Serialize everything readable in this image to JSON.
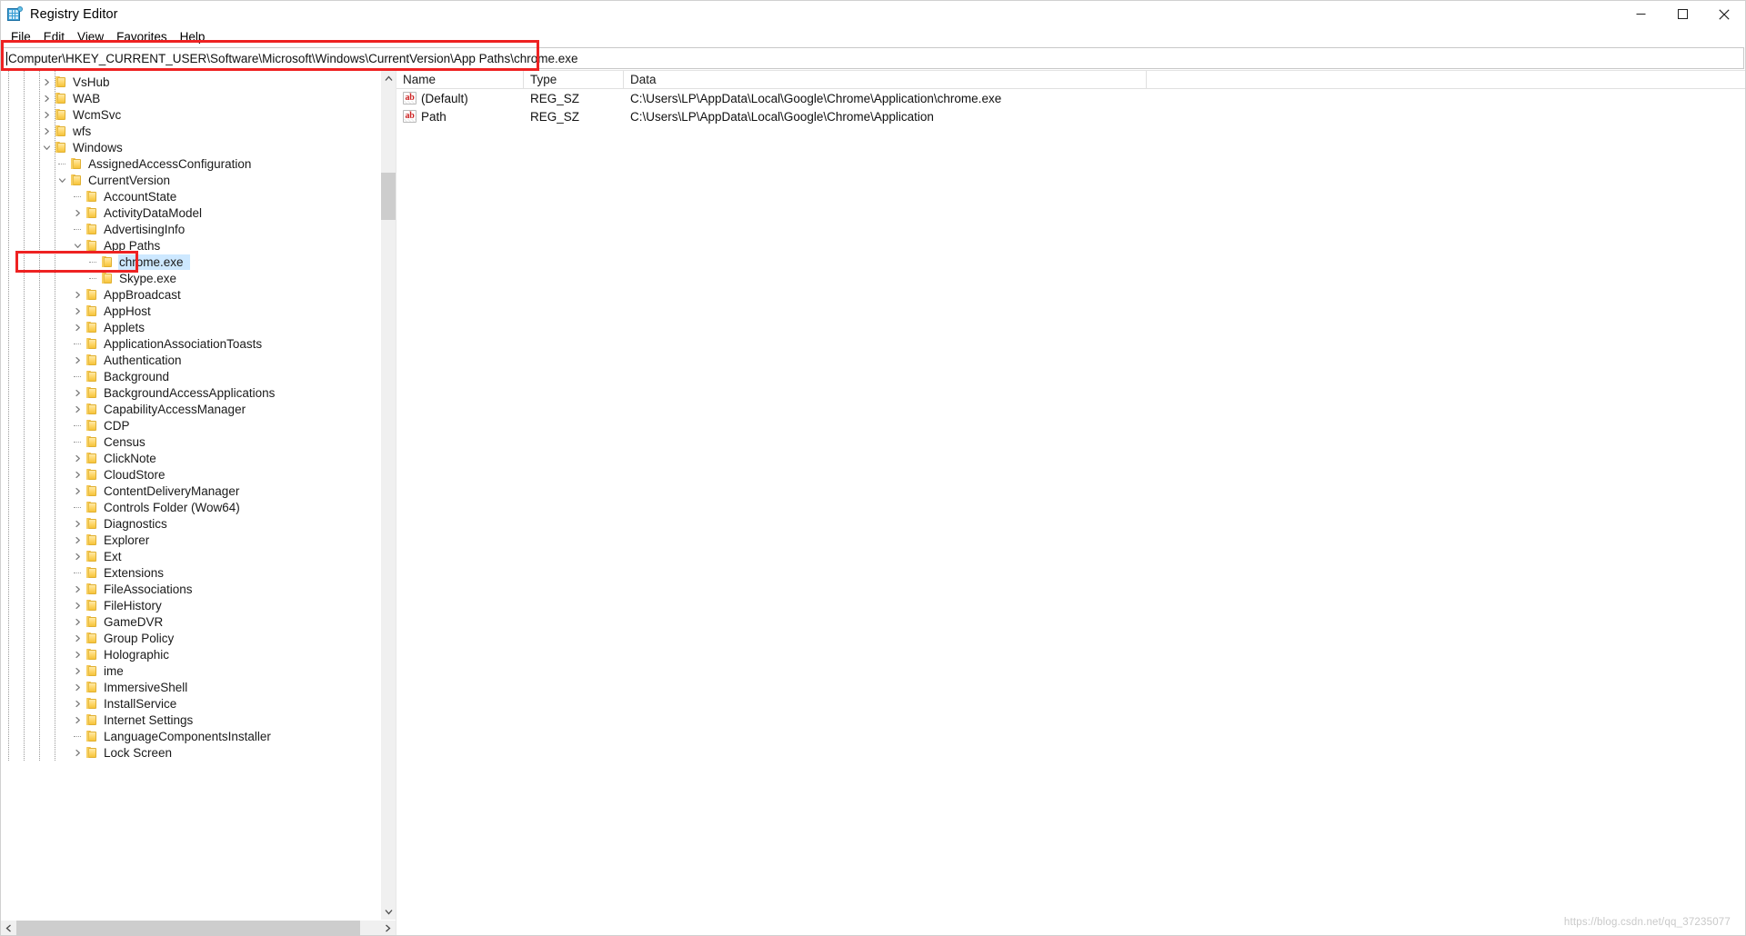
{
  "window": {
    "title": "Registry Editor",
    "icon": "registry-editor-icon",
    "minimize_label": "Minimize",
    "maximize_label": "Maximize",
    "close_label": "Close"
  },
  "menubar": {
    "items": [
      {
        "label": "File",
        "accel": "F"
      },
      {
        "label": "Edit",
        "accel": "E"
      },
      {
        "label": "View",
        "accel": "V"
      },
      {
        "label": "Favorites",
        "accel": "a"
      },
      {
        "label": "Help",
        "accel": "H"
      }
    ]
  },
  "address": {
    "value": "Computer\\HKEY_CURRENT_USER\\Software\\Microsoft\\Windows\\CurrentVersion\\App Paths\\chrome.exe",
    "placeholder": "Computer"
  },
  "tree": {
    "rows": [
      {
        "label": "VsHub",
        "indent": 3,
        "twisty": "collapsed",
        "selected": false
      },
      {
        "label": "WAB",
        "indent": 3,
        "twisty": "collapsed",
        "selected": false
      },
      {
        "label": "WcmSvc",
        "indent": 3,
        "twisty": "collapsed",
        "selected": false
      },
      {
        "label": "wfs",
        "indent": 3,
        "twisty": "collapsed",
        "selected": false
      },
      {
        "label": "Windows",
        "indent": 3,
        "twisty": "expanded",
        "selected": false
      },
      {
        "label": "AssignedAccessConfiguration",
        "indent": 4,
        "twisty": "leaf",
        "selected": false
      },
      {
        "label": "CurrentVersion",
        "indent": 4,
        "twisty": "expanded",
        "selected": false
      },
      {
        "label": "AccountState",
        "indent": 5,
        "twisty": "leaf",
        "selected": false
      },
      {
        "label": "ActivityDataModel",
        "indent": 5,
        "twisty": "collapsed",
        "selected": false
      },
      {
        "label": "AdvertisingInfo",
        "indent": 5,
        "twisty": "leaf",
        "selected": false
      },
      {
        "label": "App Paths",
        "indent": 5,
        "twisty": "expanded",
        "selected": false
      },
      {
        "label": "chrome.exe",
        "indent": 6,
        "twisty": "leaf",
        "selected": true
      },
      {
        "label": "Skype.exe",
        "indent": 6,
        "twisty": "leaf",
        "selected": false
      },
      {
        "label": "AppBroadcast",
        "indent": 5,
        "twisty": "collapsed",
        "selected": false
      },
      {
        "label": "AppHost",
        "indent": 5,
        "twisty": "collapsed",
        "selected": false
      },
      {
        "label": "Applets",
        "indent": 5,
        "twisty": "collapsed",
        "selected": false
      },
      {
        "label": "ApplicationAssociationToasts",
        "indent": 5,
        "twisty": "leaf",
        "selected": false
      },
      {
        "label": "Authentication",
        "indent": 5,
        "twisty": "collapsed",
        "selected": false
      },
      {
        "label": "Background",
        "indent": 5,
        "twisty": "leaf",
        "selected": false
      },
      {
        "label": "BackgroundAccessApplications",
        "indent": 5,
        "twisty": "collapsed",
        "selected": false
      },
      {
        "label": "CapabilityAccessManager",
        "indent": 5,
        "twisty": "collapsed",
        "selected": false
      },
      {
        "label": "CDP",
        "indent": 5,
        "twisty": "leaf",
        "selected": false
      },
      {
        "label": "Census",
        "indent": 5,
        "twisty": "leaf",
        "selected": false
      },
      {
        "label": "ClickNote",
        "indent": 5,
        "twisty": "collapsed",
        "selected": false
      },
      {
        "label": "CloudStore",
        "indent": 5,
        "twisty": "collapsed",
        "selected": false
      },
      {
        "label": "ContentDeliveryManager",
        "indent": 5,
        "twisty": "collapsed",
        "selected": false
      },
      {
        "label": "Controls Folder (Wow64)",
        "indent": 5,
        "twisty": "leaf",
        "selected": false
      },
      {
        "label": "Diagnostics",
        "indent": 5,
        "twisty": "collapsed",
        "selected": false
      },
      {
        "label": "Explorer",
        "indent": 5,
        "twisty": "collapsed",
        "selected": false
      },
      {
        "label": "Ext",
        "indent": 5,
        "twisty": "collapsed",
        "selected": false
      },
      {
        "label": "Extensions",
        "indent": 5,
        "twisty": "leaf",
        "selected": false
      },
      {
        "label": "FileAssociations",
        "indent": 5,
        "twisty": "collapsed",
        "selected": false
      },
      {
        "label": "FileHistory",
        "indent": 5,
        "twisty": "collapsed",
        "selected": false
      },
      {
        "label": "GameDVR",
        "indent": 5,
        "twisty": "collapsed",
        "selected": false
      },
      {
        "label": "Group Policy",
        "indent": 5,
        "twisty": "collapsed",
        "selected": false
      },
      {
        "label": "Holographic",
        "indent": 5,
        "twisty": "collapsed",
        "selected": false
      },
      {
        "label": "ime",
        "indent": 5,
        "twisty": "collapsed",
        "selected": false
      },
      {
        "label": "ImmersiveShell",
        "indent": 5,
        "twisty": "collapsed",
        "selected": false
      },
      {
        "label": "InstallService",
        "indent": 5,
        "twisty": "collapsed",
        "selected": false
      },
      {
        "label": "Internet Settings",
        "indent": 5,
        "twisty": "collapsed",
        "selected": false
      },
      {
        "label": "LanguageComponentsInstaller",
        "indent": 5,
        "twisty": "leaf",
        "selected": false
      },
      {
        "label": "Lock Screen",
        "indent": 5,
        "twisty": "collapsed",
        "selected": false
      }
    ]
  },
  "list": {
    "columns": [
      "Name",
      "Type",
      "Data"
    ],
    "rows": [
      {
        "icon": "string-value-icon",
        "name": "(Default)",
        "type": "REG_SZ",
        "data": "C:\\Users\\LP\\AppData\\Local\\Google\\Chrome\\Application\\chrome.exe"
      },
      {
        "icon": "string-value-icon",
        "name": "Path",
        "type": "REG_SZ",
        "data": "C:\\Users\\LP\\AppData\\Local\\Google\\Chrome\\Application"
      }
    ]
  },
  "watermark": {
    "text": "https://blog.csdn.net/qq_37235077"
  },
  "colors": {
    "annotation": "#ee2222",
    "selection": "#cde8ff",
    "folder": "#f6c43a",
    "string_icon_text": "#cc2222"
  }
}
